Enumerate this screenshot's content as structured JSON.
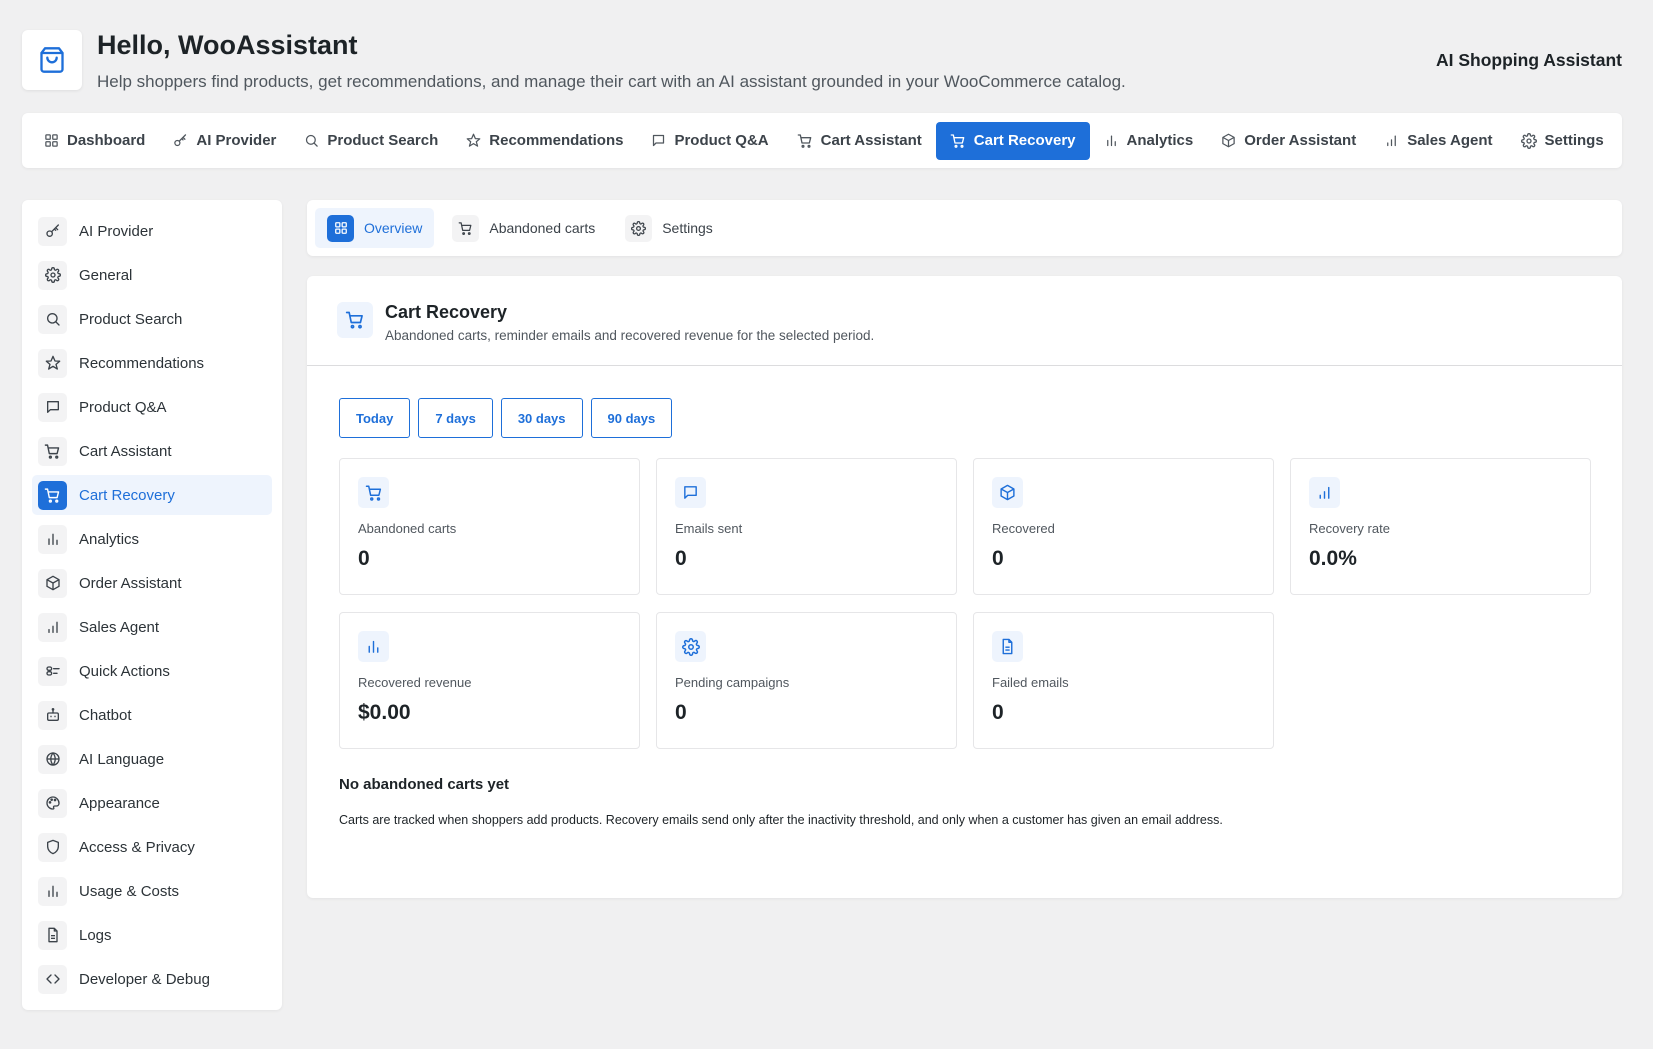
{
  "header": {
    "title": "Hello, WooAssistant",
    "subtitle": "Help shoppers find products, get recommendations, and manage their cart with an AI assistant grounded in your WooCommerce catalog.",
    "right_label": "AI Shopping Assistant",
    "logo_icon": "shopping-bag-icon"
  },
  "topnav": {
    "items": [
      {
        "label": "Dashboard",
        "icon": "grid-icon"
      },
      {
        "label": "AI Provider",
        "icon": "key-icon"
      },
      {
        "label": "Product Search",
        "icon": "search-icon"
      },
      {
        "label": "Recommendations",
        "icon": "star-icon"
      },
      {
        "label": "Product Q&A",
        "icon": "chat-icon"
      },
      {
        "label": "Cart Assistant",
        "icon": "cart-icon"
      },
      {
        "label": "Cart Recovery",
        "icon": "cart-icon",
        "active": true
      },
      {
        "label": "Analytics",
        "icon": "bar-chart-icon"
      },
      {
        "label": "Order Assistant",
        "icon": "box-icon"
      },
      {
        "label": "Sales Agent",
        "icon": "signal-icon"
      },
      {
        "label": "Settings",
        "icon": "gear-icon"
      }
    ]
  },
  "sidebar": {
    "items": [
      {
        "label": "AI Provider",
        "icon": "key-icon"
      },
      {
        "label": "General",
        "icon": "gear-icon"
      },
      {
        "label": "Product Search",
        "icon": "search-icon"
      },
      {
        "label": "Recommendations",
        "icon": "star-icon"
      },
      {
        "label": "Product Q&A",
        "icon": "chat-icon"
      },
      {
        "label": "Cart Assistant",
        "icon": "cart-icon"
      },
      {
        "label": "Cart Recovery",
        "icon": "cart-icon",
        "active": true
      },
      {
        "label": "Analytics",
        "icon": "bar-chart-icon"
      },
      {
        "label": "Order Assistant",
        "icon": "box-icon"
      },
      {
        "label": "Sales Agent",
        "icon": "signal-icon"
      },
      {
        "label": "Quick Actions",
        "icon": "toggle-icon"
      },
      {
        "label": "Chatbot",
        "icon": "robot-icon"
      },
      {
        "label": "AI Language",
        "icon": "globe-icon"
      },
      {
        "label": "Appearance",
        "icon": "palette-icon"
      },
      {
        "label": "Access & Privacy",
        "icon": "shield-icon"
      },
      {
        "label": "Usage & Costs",
        "icon": "bar-chart-icon"
      },
      {
        "label": "Logs",
        "icon": "document-icon"
      },
      {
        "label": "Developer & Debug",
        "icon": "code-icon"
      }
    ]
  },
  "subtabs": {
    "items": [
      {
        "label": "Overview",
        "icon": "grid-icon",
        "active": true
      },
      {
        "label": "Abandoned carts",
        "icon": "cart-icon"
      },
      {
        "label": "Settings",
        "icon": "gear-icon"
      }
    ]
  },
  "panel": {
    "title": "Cart Recovery",
    "description": "Abandoned carts, reminder emails and recovered revenue for the selected period.",
    "icon": "cart-icon",
    "ranges": [
      "Today",
      "7 days",
      "30 days",
      "90 days"
    ],
    "cards": [
      {
        "label": "Abandoned carts",
        "value": "0",
        "icon": "cart-icon"
      },
      {
        "label": "Emails sent",
        "value": "0",
        "icon": "chat-icon"
      },
      {
        "label": "Recovered",
        "value": "0",
        "icon": "box-icon"
      },
      {
        "label": "Recovery rate",
        "value": "0.0%",
        "icon": "signal-icon"
      },
      {
        "label": "Recovered revenue",
        "value": "$0.00",
        "icon": "bar-chart-icon"
      },
      {
        "label": "Pending campaigns",
        "value": "0",
        "icon": "gear-icon"
      },
      {
        "label": "Failed emails",
        "value": "0",
        "icon": "document-icon"
      }
    ],
    "empty_title": "No abandoned carts yet",
    "empty_desc": "Carts are tracked when shoppers add products. Recovery emails send only after the inactivity threshold, and only when a customer has given an email address."
  },
  "colors": {
    "accent": "#1e6fd9",
    "accent_light": "#eef4fd",
    "background": "#f0f0f1"
  }
}
